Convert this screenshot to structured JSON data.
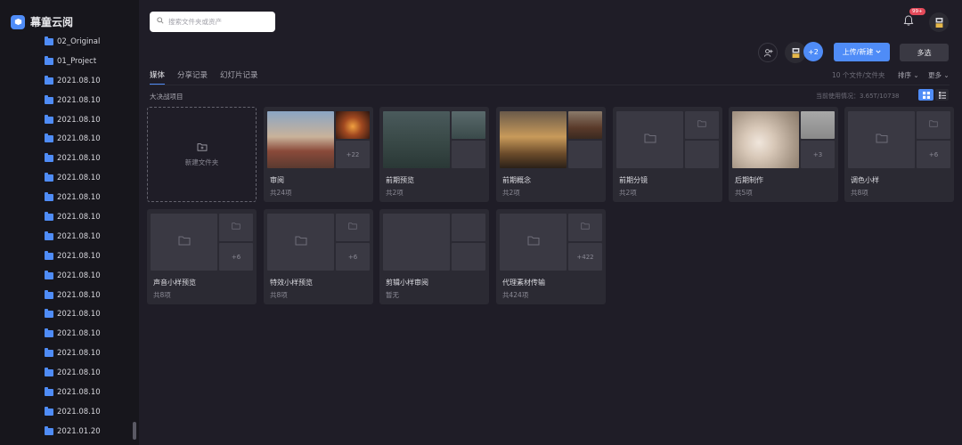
{
  "brand": {
    "name": "幕童云阅"
  },
  "sidebar": {
    "items": [
      "02_Original",
      "01_Project",
      "2021.08.10",
      "2021.08.10",
      "2021.08.10",
      "2021.08.10",
      "2021.08.10",
      "2021.08.10",
      "2021.08.10",
      "2021.08.10",
      "2021.08.10",
      "2021.08.10",
      "2021.08.10",
      "2021.08.10",
      "2021.08.10",
      "2021.08.10",
      "2021.08.10",
      "2021.08.10",
      "2021.08.10",
      "2021.08.10",
      "2021.01.20"
    ]
  },
  "search": {
    "placeholder": "搜索文件夹或资产"
  },
  "header": {
    "notification_count": "99+",
    "member_more": "+2",
    "upload_label": "上传/新建",
    "multi_select_label": "多选"
  },
  "tabs": [
    {
      "label": "媒体",
      "active": true
    },
    {
      "label": "分享记录",
      "active": false
    },
    {
      "label": "幻灯片记录",
      "active": false
    }
  ],
  "toolbar": {
    "file_count": "10 个文件/文件夹",
    "sort_label": "排序",
    "more_label": "更多"
  },
  "crumb": "大决战项目",
  "usage": "当前使用情况：3.65T/10738",
  "new_folder_label": "新建文件夹",
  "cards": [
    {
      "title": "审阅",
      "count": "共24项",
      "extra": "+22",
      "style": "photo1"
    },
    {
      "title": "前期预览",
      "count": "共2项",
      "extra": "",
      "style": "photo2"
    },
    {
      "title": "前期概念",
      "count": "共2项",
      "extra": "",
      "style": "photo3"
    },
    {
      "title": "前期分镜",
      "count": "共2项",
      "extra": "",
      "style": "folder"
    },
    {
      "title": "后期制作",
      "count": "共5项",
      "extra": "+3",
      "style": "photo4"
    },
    {
      "title": "调色小样",
      "count": "共8项",
      "extra": "+6",
      "style": "folder"
    },
    {
      "title": "声音小样预览",
      "count": "共8项",
      "extra": "+6",
      "style": "folder"
    },
    {
      "title": "特效小样预览",
      "count": "共8项",
      "extra": "+6",
      "style": "folder"
    },
    {
      "title": "剪辑小样审阅",
      "count": "暂无",
      "extra": "",
      "style": "empty"
    },
    {
      "title": "代理素材传输",
      "count": "共424项",
      "extra": "+422",
      "style": "folder"
    }
  ],
  "colors": {
    "accent": "#4f8cf7",
    "badge": "#e34a5a",
    "card": "#2b2a33",
    "background": "#1f1d27",
    "sidebar": "#17161c"
  }
}
